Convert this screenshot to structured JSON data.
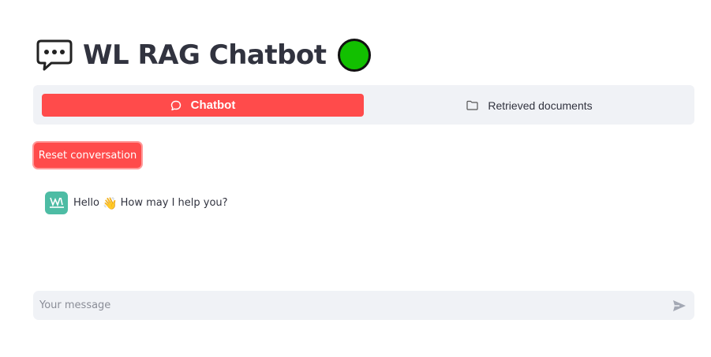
{
  "header": {
    "title": "WL RAG Chatbot",
    "status_color": "#12c000",
    "title_icon": "speech-bubble-icon"
  },
  "tabs": [
    {
      "label": "Chatbot",
      "icon": "chat-bubble-icon",
      "active": true
    },
    {
      "label": "Retrieved documents",
      "icon": "folder-icon",
      "active": false
    }
  ],
  "actions": {
    "reset_label": "Reset conversation"
  },
  "messages": [
    {
      "role": "assistant",
      "avatar": "worldline-logo",
      "text_before": "Hello",
      "emoji": "👋",
      "text_after": "How may I help you?"
    }
  ],
  "composer": {
    "placeholder": "Your message",
    "send_icon": "send-icon"
  },
  "colors": {
    "accent": "#ff4b4b",
    "panel": "#f0f2f6",
    "avatar_bg": "#4dbca4"
  }
}
